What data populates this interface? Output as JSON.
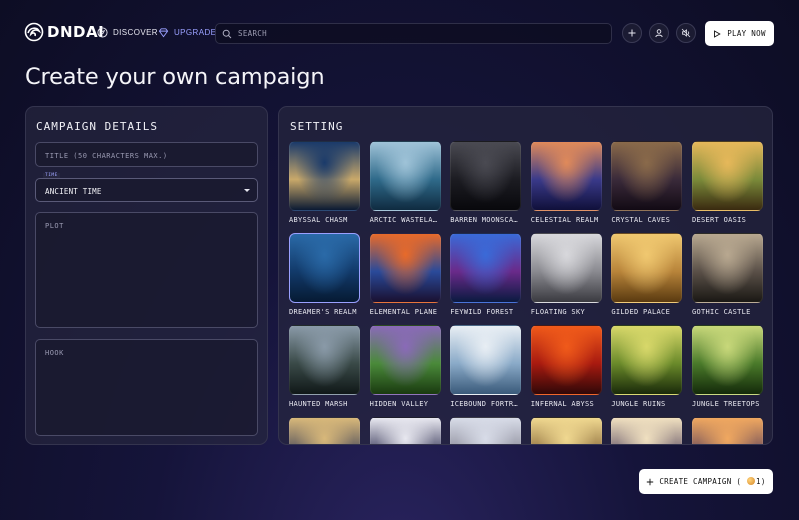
{
  "nav": {
    "logo_text": "DNDAI",
    "discover_label": "DISCOVER",
    "upgrade_label": "UPGRADE",
    "search_placeholder": "SEARCH",
    "play_label": "PLAY NOW",
    "icons": [
      "plus-icon",
      "user-icon",
      "speaker-muted-icon"
    ]
  },
  "page": {
    "title": "Create your own campaign"
  },
  "details": {
    "heading": "CAMPAIGN DETAILS",
    "title_placeholder": "TITLE (50 CHARACTERS MAX.)",
    "time_label": "TIME",
    "time_value": "ANCIENT TIME",
    "plot_placeholder": "PLOT",
    "hook_placeholder": "HOOK"
  },
  "setting": {
    "heading": "SETTING",
    "selected": "DREAMER'S REALM",
    "tiles": [
      {
        "label": "ABYSSAL CHASM",
        "colors": [
          "#1a3a6a",
          "#c9a96a",
          "#0b1a33"
        ]
      },
      {
        "label": "ARCTIC WASTELA…",
        "colors": [
          "#9fc3d8",
          "#2f6a8a",
          "#0f2b40"
        ]
      },
      {
        "label": "BARREN MOONSCA…",
        "colors": [
          "#4a4a52",
          "#1c1c22",
          "#08080c"
        ]
      },
      {
        "label": "CELESTIAL REALM",
        "colors": [
          "#e08a5a",
          "#3a3a8a",
          "#10103a"
        ]
      },
      {
        "label": "CRYSTAL CAVES",
        "colors": [
          "#8a6a4a",
          "#3a2a3a",
          "#120a14"
        ]
      },
      {
        "label": "DESERT OASIS",
        "colors": [
          "#e6b85a",
          "#7a8a3a",
          "#3a2a10"
        ]
      },
      {
        "label": "DREAMER'S REALM",
        "colors": [
          "#2a6aa8",
          "#123a6a",
          "#061a33"
        ]
      },
      {
        "label": "ELEMENTAL PLANE",
        "colors": [
          "#e86a2a",
          "#2a4a9a",
          "#1a1030"
        ]
      },
      {
        "label": "FEYWILD FOREST",
        "colors": [
          "#3a6ad8",
          "#6a2a8a",
          "#0a1a40"
        ]
      },
      {
        "label": "FLOATING SKY",
        "colors": [
          "#d8d8dc",
          "#8a8a90",
          "#3a3a40"
        ]
      },
      {
        "label": "GILDED PALACE",
        "colors": [
          "#f0c870",
          "#b8843a",
          "#5a3a10"
        ]
      },
      {
        "label": "GOTHIC CASTLE",
        "colors": [
          "#b8a890",
          "#5a5048",
          "#1a1814"
        ]
      },
      {
        "label": "HAUNTED MARSH",
        "colors": [
          "#8a9aa8",
          "#3a4a48",
          "#101818"
        ]
      },
      {
        "label": "HIDDEN VALLEY",
        "colors": [
          "#8a6ab8",
          "#4a8a3a",
          "#1a3a10"
        ]
      },
      {
        "label": "ICEBOUND FORTR…",
        "colors": [
          "#e8eef4",
          "#8aaac8",
          "#3a5a7a"
        ]
      },
      {
        "label": "INFERNAL ABYSS",
        "colors": [
          "#f05a1a",
          "#a81a10",
          "#300808"
        ]
      },
      {
        "label": "JUNGLE RUINS",
        "colors": [
          "#d8d86a",
          "#6a8a2a",
          "#1a2a0a"
        ]
      },
      {
        "label": "JUNGLE TREETOPS",
        "colors": [
          "#c8d87a",
          "#4a7a2a",
          "#142a0a"
        ]
      },
      {
        "label": "",
        "colors": [
          "#d8b87a",
          "#4a4a5a",
          "#1a1a28"
        ]
      },
      {
        "label": "",
        "colors": [
          "#e8e8f0",
          "#3a3a5a",
          "#0a0a1a"
        ]
      },
      {
        "label": "",
        "colors": [
          "#d8dce8",
          "#8a8a98",
          "#2a2a38"
        ]
      },
      {
        "label": "",
        "colors": [
          "#f0d890",
          "#8a6a3a",
          "#1a1410"
        ]
      },
      {
        "label": "",
        "colors": [
          "#f0e0c0",
          "#6a5a6a",
          "#1a1420"
        ]
      },
      {
        "label": "",
        "colors": [
          "#f0a860",
          "#6a4a5a",
          "#141020"
        ]
      }
    ]
  },
  "create": {
    "label_prefix": "CREATE CAMPAIGN (",
    "count": "1",
    "label_suffix": ")"
  }
}
